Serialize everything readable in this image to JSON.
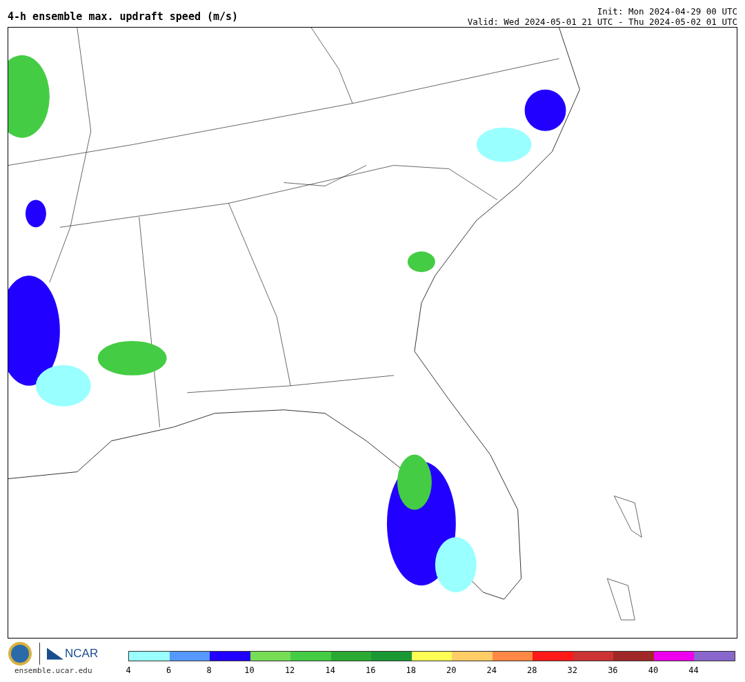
{
  "title": "4-h ensemble max. updraft speed (m/s)",
  "init": "Init: Mon 2024-04-29 00 UTC",
  "valid": "Valid: Wed 2024-05-01 21 UTC - Thu 2024-05-02 01 UTC",
  "logo": {
    "org": "NCAR",
    "url": "ensemble.ucar.edu"
  },
  "colorbar": [
    {
      "color": "#99ffff",
      "tick": "4"
    },
    {
      "color": "#5599ff",
      "tick": "6"
    },
    {
      "color": "#2200ff",
      "tick": "8"
    },
    {
      "color": "#77dd55",
      "tick": "10"
    },
    {
      "color": "#44cc44",
      "tick": "12"
    },
    {
      "color": "#2aaa33",
      "tick": "14"
    },
    {
      "color": "#1a9933",
      "tick": "16"
    },
    {
      "color": "#ffff55",
      "tick": "18"
    },
    {
      "color": "#ffcc66",
      "tick": "20"
    },
    {
      "color": "#ff8844",
      "tick": "24"
    },
    {
      "color": "#ff1a1a",
      "tick": "28"
    },
    {
      "color": "#cc3333",
      "tick": "32"
    },
    {
      "color": "#a02828",
      "tick": "36"
    },
    {
      "color": "#ee00ee",
      "tick": "40"
    },
    {
      "color": "#8866cc",
      "tick": "44"
    }
  ]
}
